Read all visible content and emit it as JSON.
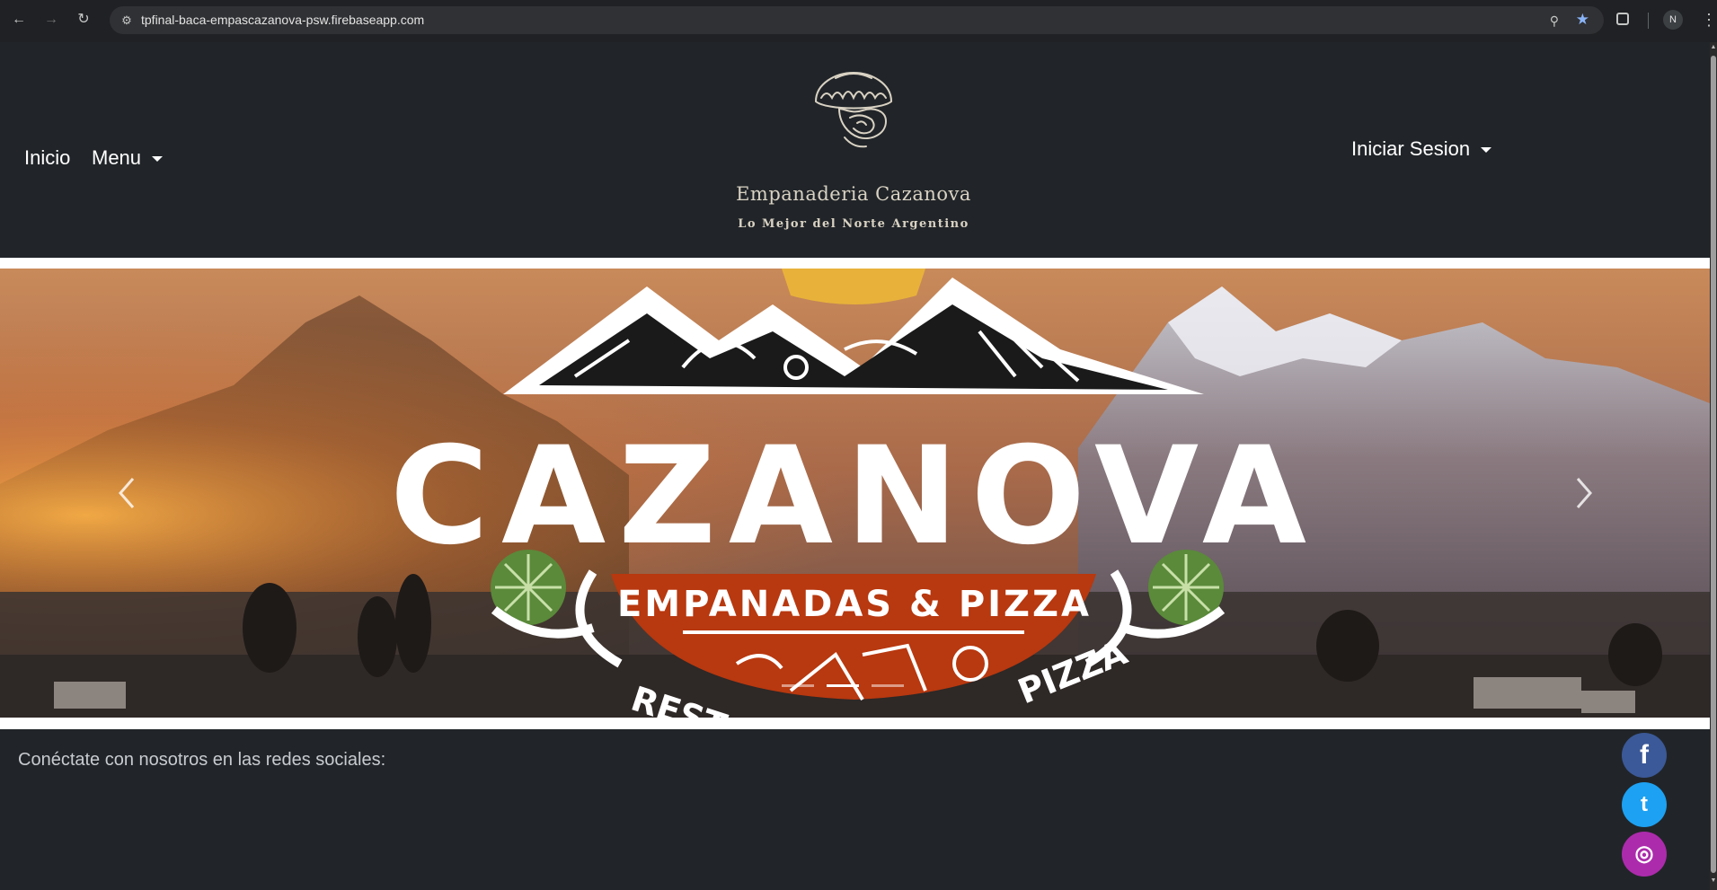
{
  "browser": {
    "url": "tpfinal-baca-empascazanova-psw.firebaseapp.com",
    "profile_initial": "N",
    "icons": [
      "back-arrow-icon",
      "forward-arrow-icon",
      "reload-icon",
      "site-info-icon",
      "zoom-icon",
      "bookmark-star-icon",
      "extensions-icon",
      "kebab-menu-icon"
    ]
  },
  "navbar": {
    "home_label": "Inicio",
    "menu_label": "Menu",
    "login_label": "Iniciar Sesion",
    "brand_name": "Empanaderia Cazanova",
    "brand_tagline": "Lo Mejor del Norte Argentino"
  },
  "hero": {
    "logo_title": "CAZANOVA",
    "logo_subtitle": "EMPANADAS & PIZZA",
    "arc_left": "REST",
    "arc_right": "PIZZA",
    "slide_indicators": 3,
    "active_slide": 1
  },
  "footer": {
    "social_text": "Conéctate con nosotros en las redes sociales:",
    "facebook_glyph": "f",
    "twitter_glyph": "t",
    "instagram_glyph": "◎"
  },
  "colors": {
    "page_bg": "#212529",
    "chrome_bg": "#202124",
    "facebook": "#3b5998",
    "twitter": "#1da1f2",
    "instagram": "#ac2bac",
    "logo_red": "#b8380f",
    "logo_green": "#5a8a3a"
  }
}
